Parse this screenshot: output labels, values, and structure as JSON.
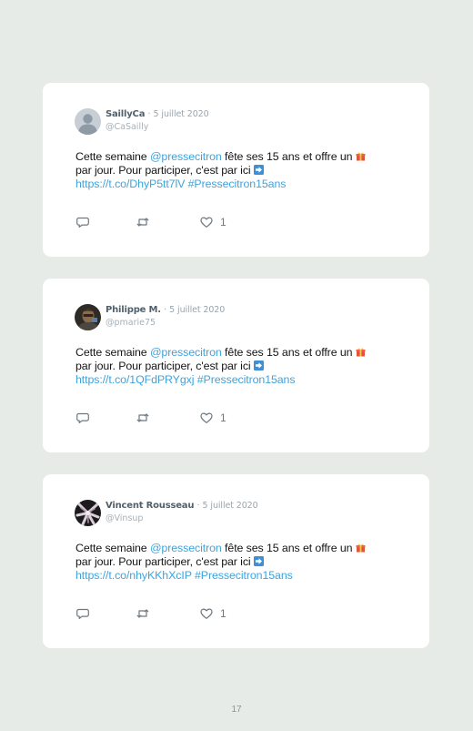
{
  "tweets": [
    {
      "name": "SaillyCa",
      "separator": "·",
      "date": "5 juillet 2020",
      "handle": "@CaSailly",
      "text_before": "Cette semaine ",
      "mention": "@pressecitron",
      "text_mid": " fête ses 15 ans et offre un ",
      "gift_emoji": "gift-emoji",
      "text_line2": " par jour. Pour participer, c'est par ici ",
      "arrow_emoji": "right-arrow-emoji",
      "link": "https://t.co/DhyP5tt7lV",
      "hashtag": "#Pressecitron15ans",
      "likes": "1",
      "avatar": "default-avatar"
    },
    {
      "name": "Philippe M.",
      "separator": "·",
      "date": "5 juillet 2020",
      "handle": "@pmarie75",
      "text_before": "Cette semaine ",
      "mention": "@pressecitron",
      "text_mid": " fête ses 15 ans et offre un ",
      "gift_emoji": "gift-emoji",
      "text_line2": " par jour. Pour participer, c'est par ici ",
      "arrow_emoji": "right-arrow-emoji",
      "link": "https://t.co/1QFdPRYgxj",
      "hashtag": "#Pressecitron15ans",
      "likes": "1",
      "avatar": "photo-avatar"
    },
    {
      "name": "Vincent Rousseau",
      "separator": "·",
      "date": "5 juillet 2020",
      "handle": "@Vinsup",
      "text_before": "Cette semaine ",
      "mention": "@pressecitron",
      "text_mid": " fête ses 15 ans et offre un ",
      "gift_emoji": "gift-emoji",
      "text_line2": " par jour. Pour participer, c'est par ici ",
      "arrow_emoji": "right-arrow-emoji",
      "link": "https://t.co/nhyKKhXcIP",
      "hashtag": "#Pressecitron15ans",
      "likes": "1",
      "avatar": "photo-avatar"
    }
  ],
  "page_number": "17",
  "colors": {
    "background": "#e7ebe7",
    "card": "#ffffff",
    "link": "#3fa3dc",
    "name": "#52606b",
    "meta": "#9aa5ad",
    "icon": "#6d7881"
  },
  "icons": {
    "reply": "reply-icon",
    "retweet": "retweet-icon",
    "like": "heart-icon"
  }
}
